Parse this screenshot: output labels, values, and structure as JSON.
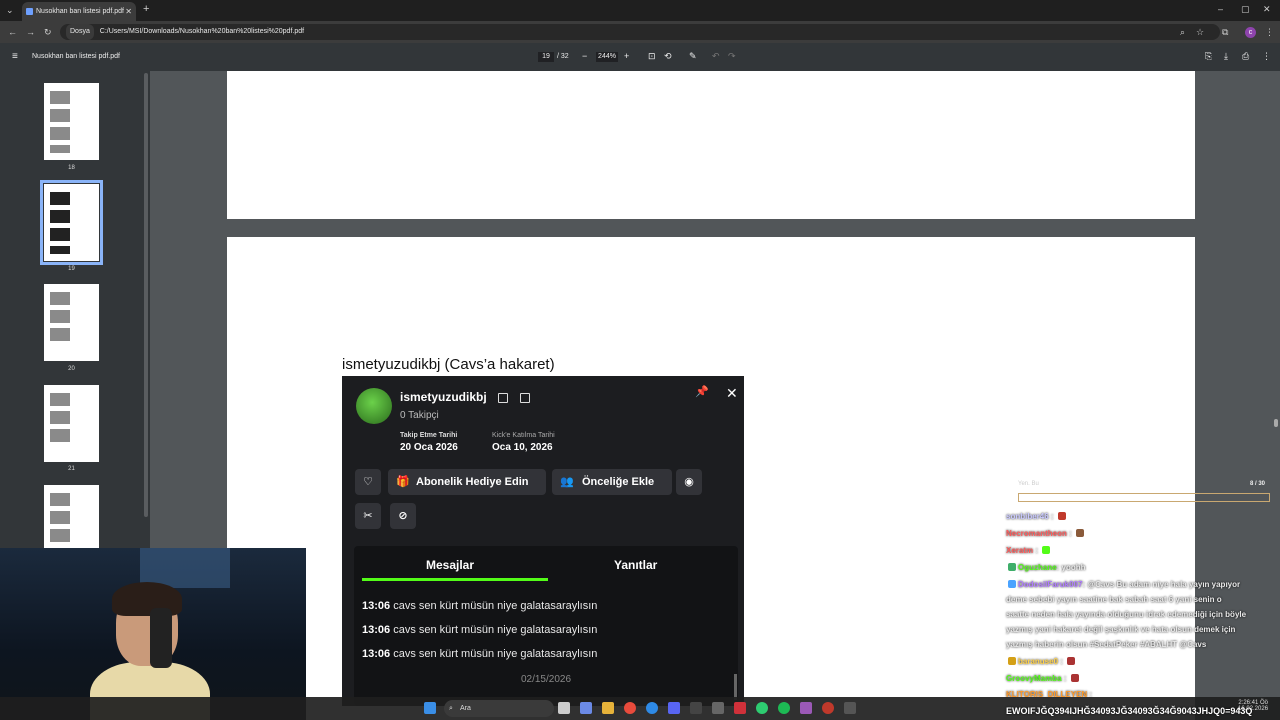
{
  "browser": {
    "tab_title": "Nusokhan ban listesi pdf.pdf",
    "address_chip": "Dosya",
    "address_url": "C:/Users/MSI/Downloads/Nusokhan%20ban%20listesi%20pdf.pdf",
    "profile_initial": "c"
  },
  "pdf_toolbar": {
    "title": "Nusokhan ban listesi pdf.pdf",
    "current_page": "19",
    "page_total": "/ 32",
    "zoom": "244%"
  },
  "sidebar": {
    "thumbs": [
      {
        "label": "18"
      },
      {
        "label": "19"
      },
      {
        "label": "20"
      },
      {
        "label": "21"
      }
    ]
  },
  "document": {
    "caption": "ismetyuzudikbj (Cavs’a hakaret)",
    "card": {
      "username": "ismetyuzudikbj",
      "followers": "0 Takipçi",
      "follow_date_label": "Takip Etme Tarihi",
      "follow_date": "20 Oca 2026",
      "join_date_label": "Kick'e Katılma Tarihi",
      "join_date": "Oca 10, 2026",
      "gift_button": "Abonelik Hediye Edin",
      "priority_button": "Önceliğe Ekle",
      "tab_messages": "Mesajlar",
      "tab_replies": "Yanıtlar",
      "messages": [
        {
          "time": "13:06",
          "text": "cavs sen kürt müsün niye galatasaraylısın"
        },
        {
          "time": "13:06",
          "text": "cavs sen kürt müsün niye galatasaraylısın"
        },
        {
          "time": "13:06",
          "text": "cavs sen kürt müsün niye galatasaraylısın"
        }
      ],
      "date_separator": "02/15/2026"
    }
  },
  "stream_chat": {
    "count": "8 / 30",
    "lines": [
      {
        "user": "sonbiber46",
        "text": "",
        "color": "#c9c9ff"
      },
      {
        "user": "Necromantheon",
        "text": "",
        "color": "#ff5a5a"
      },
      {
        "user": "Xeratm",
        "text": "",
        "color": "#ff5a5a"
      },
      {
        "user": "Oguzhane",
        "text": ": yoohh",
        "color": "#53fc18"
      },
      {
        "user": "DodosilFaruk007",
        "text": ": @Cavs Bu adam niye hala yayın yapıyor",
        "color": "#b07cff"
      },
      {
        "user": "",
        "text": "deme sebebi yayın saatine bak sabah saat 6 yani senin o",
        "color": "#ffffff"
      },
      {
        "user": "",
        "text": "saatte neden hala yayında olduğunu idrak edemediği için böyle",
        "color": "#ffffff"
      },
      {
        "user": "",
        "text": "yazmış yani hakaret değil şaşkınlık ve hata olsun demek için",
        "color": "#ffffff"
      },
      {
        "user": "",
        "text": "yazmış haberin olsun #SedatPeker #ABALHT @Cavs",
        "color": "#ffffff"
      },
      {
        "user": "baranuse0",
        "text": "",
        "color": "#ffd24a"
      },
      {
        "user": "GroovyMamba",
        "text": "",
        "color": "#53fc18"
      },
      {
        "user": "KLITORIS_DILLEYEN",
        "text": "",
        "color": "#ff9a2a"
      }
    ],
    "marquee": "EWOIFJĞQ394IJHĞ34093JĞ34093Ğ34Ğ9043JHJQ0=943Q"
  },
  "taskbar": {
    "search_placeholder": "Ara",
    "clock_time": "2:26:41 Öö",
    "clock_date": "16.02.2026"
  }
}
